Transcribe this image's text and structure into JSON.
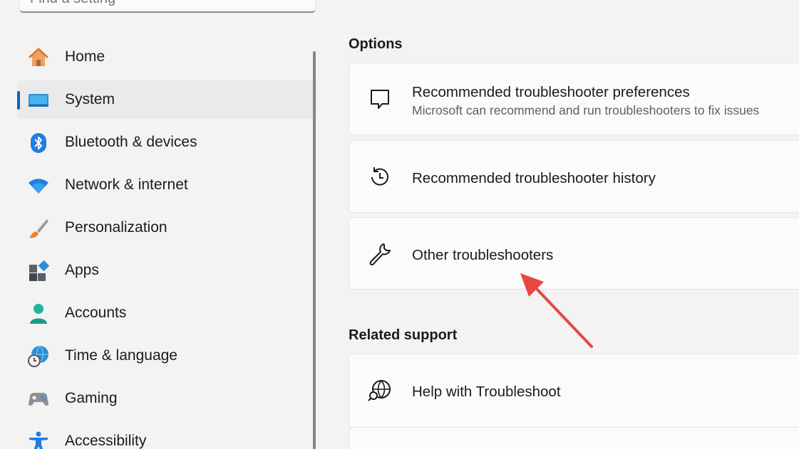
{
  "search": {
    "placeholder": "Find a setting"
  },
  "sidebar": {
    "items": [
      {
        "label": "Home",
        "icon": "home-icon"
      },
      {
        "label": "System",
        "icon": "system-icon",
        "selected": true
      },
      {
        "label": "Bluetooth & devices",
        "icon": "bluetooth-icon"
      },
      {
        "label": "Network & internet",
        "icon": "wifi-icon"
      },
      {
        "label": "Personalization",
        "icon": "brush-icon"
      },
      {
        "label": "Apps",
        "icon": "apps-icon"
      },
      {
        "label": "Accounts",
        "icon": "accounts-icon"
      },
      {
        "label": "Time & language",
        "icon": "time-language-icon"
      },
      {
        "label": "Gaming",
        "icon": "gamepad-icon"
      },
      {
        "label": "Accessibility",
        "icon": "accessibility-icon"
      }
    ]
  },
  "options": {
    "title": "Options",
    "cards": [
      {
        "title": "Recommended troubleshooter preferences",
        "subtitle": "Microsoft can recommend and run troubleshooters to fix issues",
        "icon": "chat-bubble-icon"
      },
      {
        "title": "Recommended troubleshooter history",
        "icon": "history-icon"
      },
      {
        "title": "Other troubleshooters",
        "icon": "wrench-icon"
      }
    ]
  },
  "related": {
    "title": "Related support",
    "cards": [
      {
        "title": "Help with Troubleshoot",
        "icon": "globe-search-icon"
      }
    ]
  },
  "colors": {
    "accent": "#0067c0",
    "annotation_arrow": "#e8473f"
  }
}
